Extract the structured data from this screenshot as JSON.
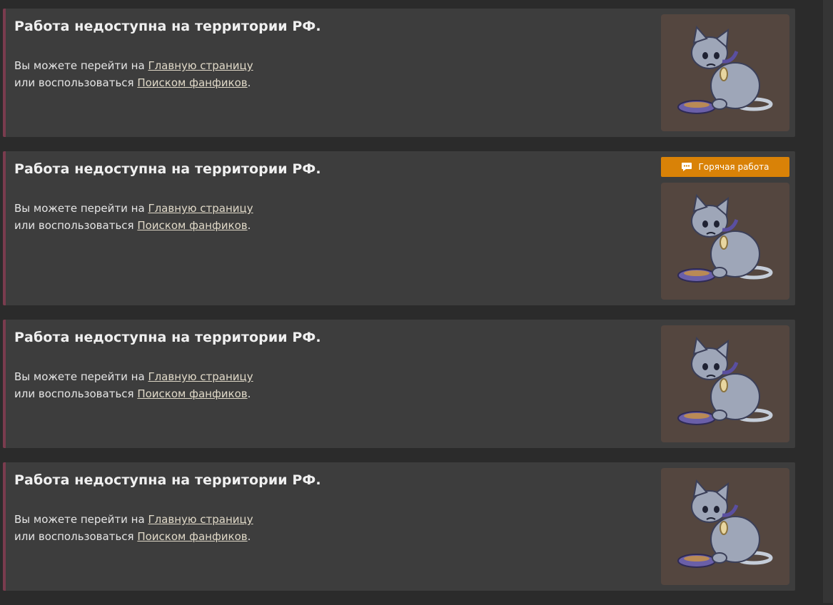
{
  "cards": [
    {
      "title": "Работа недоступна на территории РФ.",
      "line1_prefix": "Вы можете перейти на ",
      "link_main": "Главную страницу",
      "line2_prefix": "или воспользоваться ",
      "link_search": "Поиском фанфиков",
      "suffix": "."
    },
    {
      "title": "Работа недоступна на территории РФ.",
      "line1_prefix": "Вы можете перейти на ",
      "link_main": "Главную страницу",
      "line2_prefix": "или воспользоваться ",
      "link_search": "Поиском фанфиков",
      "suffix": ".",
      "badge": "Горячая работа"
    },
    {
      "title": "Работа недоступна на территории РФ.",
      "line1_prefix": "Вы можете перейти на ",
      "link_main": "Главную страницу",
      "line2_prefix": "или воспользоваться ",
      "link_search": "Поиском фанфиков",
      "suffix": "."
    },
    {
      "title": "Работа недоступна на территории РФ.",
      "line1_prefix": "Вы можете перейти на ",
      "link_main": "Главную страницу",
      "line2_prefix": "или воспользоваться ",
      "link_search": "Поиском фанфиков",
      "suffix": "."
    }
  ],
  "icons": {
    "badge_icon": "chat-bubble-icon",
    "thumbnail": "sad-cat-icon"
  },
  "colors": {
    "accent": "#7a3c4e",
    "badge": "#d98207",
    "card": "#3d3d3d",
    "thumb_bg": "#54463f"
  }
}
